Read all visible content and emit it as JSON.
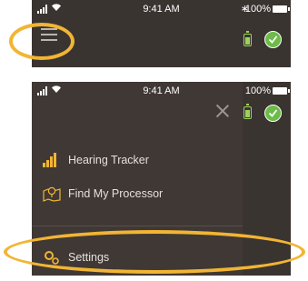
{
  "status_bar": {
    "time": "9:41 AM",
    "battery_percent": "100%"
  },
  "menu": {
    "items": [
      {
        "label": "Hearing Tracker",
        "icon": "signal-bars-icon"
      },
      {
        "label": "Find My Processor",
        "icon": "map-pin-icon"
      },
      {
        "label": "Settings",
        "icon": "gear-icon"
      }
    ]
  },
  "colors": {
    "background": "#3a3431",
    "drawer": "#3f3835",
    "highlight": "#f2b533",
    "status_green": "#6dbb48"
  },
  "icons": {
    "menu": "hamburger-icon",
    "close": "close-icon",
    "battery": "battery-icon",
    "status": "checkmark-circle-icon"
  }
}
